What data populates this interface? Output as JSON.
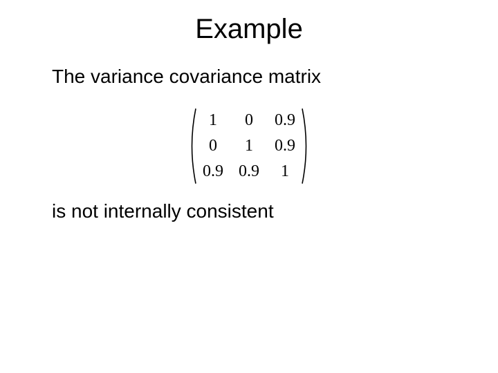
{
  "title": "Example",
  "body": {
    "line1": "The variance covariance matrix",
    "line2": "is not internally consistent"
  },
  "matrix": {
    "rows": [
      [
        "1",
        "0",
        "0.9"
      ],
      [
        "0",
        "1",
        "0.9"
      ],
      [
        "0.9",
        "0.9",
        "1"
      ]
    ]
  }
}
